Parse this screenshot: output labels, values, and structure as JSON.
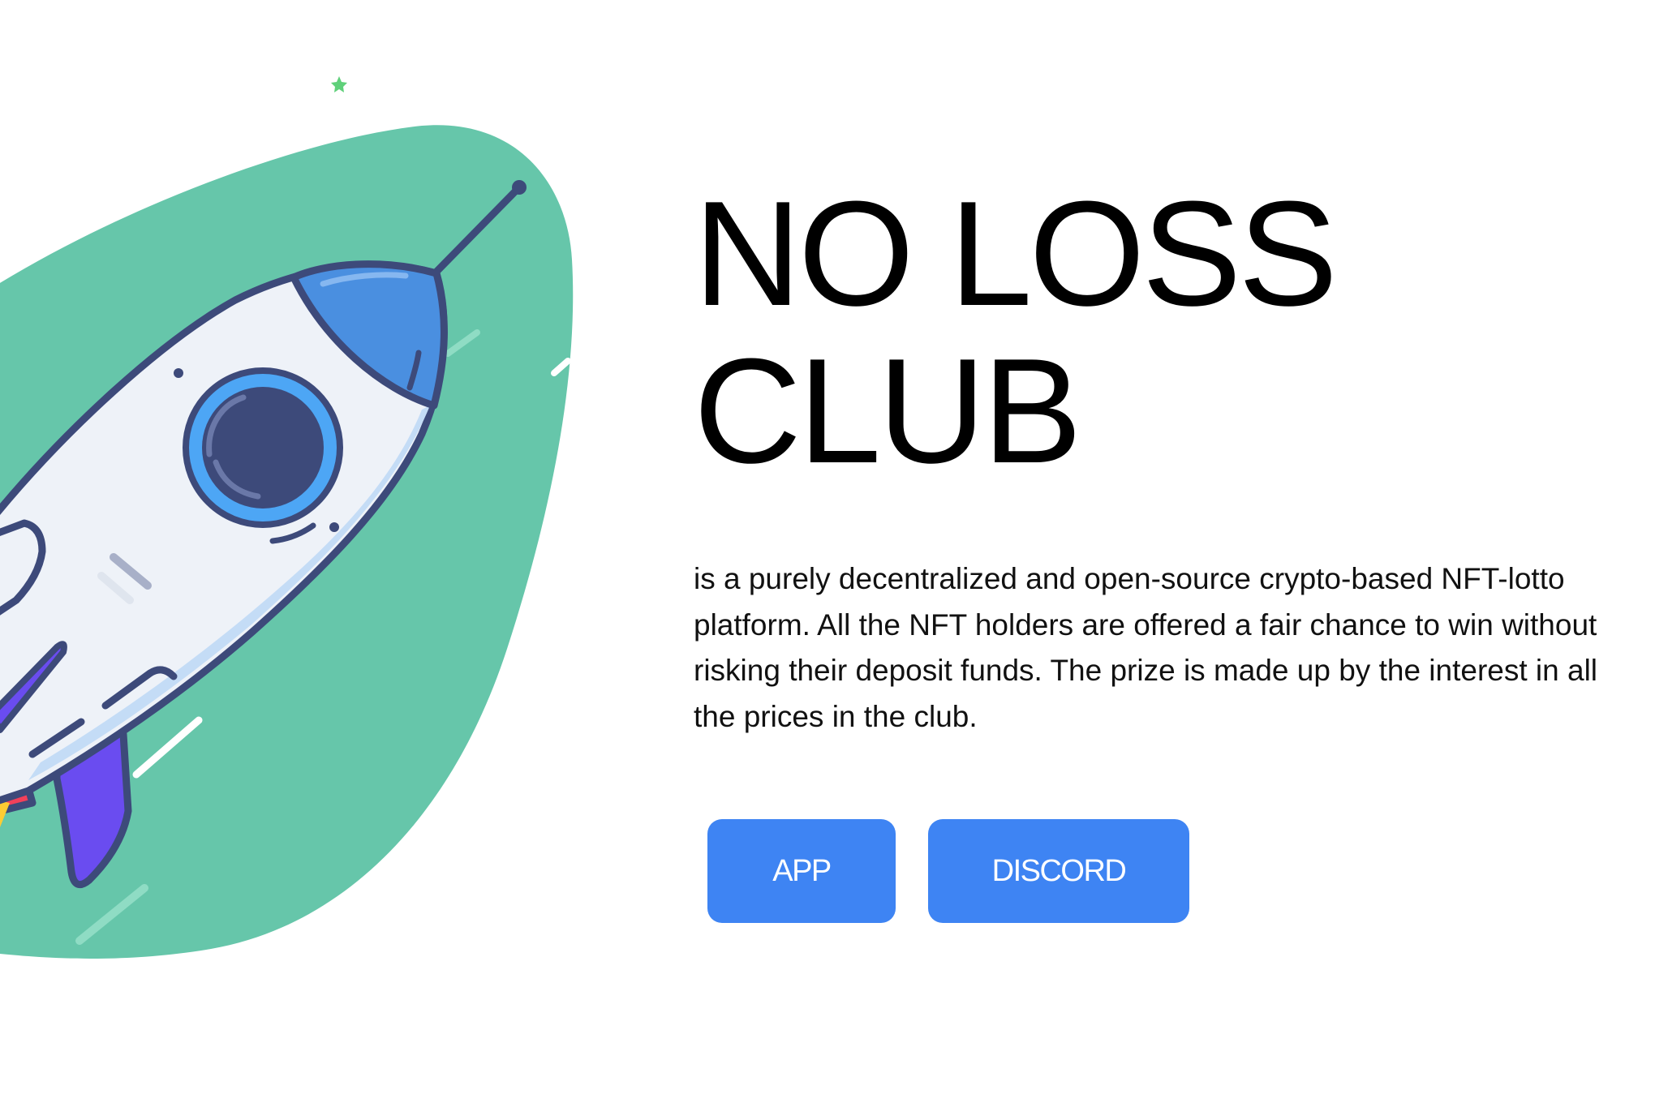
{
  "hero": {
    "title_line1": "NO LOSS",
    "title_line2": "CLUB",
    "description": "is a purely decentralized and open-source crypto-based NFT-lotto platform. All the NFT holders are offered a fair chance to win without risking their deposit funds. The prize is made up by the interest in all the prices in the club."
  },
  "actions": {
    "app_label": "APP",
    "discord_label": "DISCORD"
  },
  "illustration": {
    "icon": "rocket-icon",
    "colors": {
      "blob": "#66c6aa",
      "rocket_body": "#eef2f8",
      "rocket_nose": "#4a8fe0",
      "outline": "#3d4a7a",
      "flame": "#6a4cf0",
      "accent_red": "#f2405a"
    }
  },
  "colors": {
    "button": "#3e84f3",
    "text": "#000000",
    "background": "#ffffff"
  }
}
